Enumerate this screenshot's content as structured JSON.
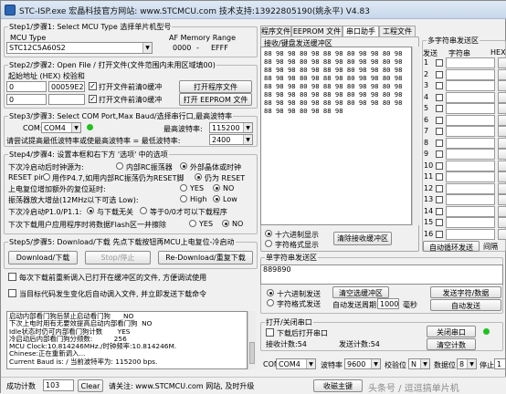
{
  "app": {
    "title": "STC-ISP.exe    宏晶科技官方网站: www.STCMCU.com  技术支持:13922805190(姚永平)  V4.83",
    "accent_color": "#2a66b8"
  },
  "step1": {
    "label": "Step1/步骤1: Select MCU Type  选择单片机型号",
    "mcu_type_label": "MCU Type",
    "af_label": "AF Memory Range",
    "mcu_value": "STC12C5A60S2",
    "range_start": "0000",
    "range_sep": "-",
    "range_end": "EFFF"
  },
  "step2": {
    "label": "Step2/步骤2: Open File / 打开文件(文件范围内未用区域填00)",
    "start_addr_label": "起始地址 (HEX)  校验和",
    "addr1": "0",
    "checksum1": "00059E2H",
    "clear_buffer1": "打开文件前清0缓冲",
    "open_program_btn": "打开程序文件",
    "addr2": "0",
    "checksum2": "",
    "clear_buffer2": "打开文件前清0缓冲",
    "open_eeprom_btn": "打开 EEPROM 文件"
  },
  "step3": {
    "label": "Step3/步骤3: Select COM Port,Max Baud/选择串行口,最高波特率",
    "com_label": "COM:",
    "com_value": "COM4",
    "max_baud_label": "最高波特率:",
    "max_baud_value": "115200",
    "min_note": "请尝试提高最低波特率或使最高波特率  =  最低波特率:",
    "min_baud_value": "2400"
  },
  "step4": {
    "label": "Step4/步骤4: 设置本框和右下方 '选项' 中的选项",
    "cold_boot_label": "下次冷启动后时钟源为:",
    "opt_internal_rc": "内部RC振荡器",
    "opt_external": "外部晶体或时钟",
    "reset_pin_label": "RESET pin",
    "opt_p4_7": "用作P4.7,如用内部RC振荡仍为RESET脚",
    "opt_reset": "仍为 RESET",
    "power_delay_label": "上电复位增加额外的复位延时:",
    "opt_yes": "YES",
    "opt_no": "NO",
    "osc_gain_label": "振荡器放大增益(12MHz以下可选 Low):",
    "opt_high": "High",
    "opt_low": "Low",
    "cold_boot_p1_label": "下次冷启动P1.0/P1.1:",
    "opt_p1_any": "与下载无关",
    "opt_p1_zero": "等于0/0才可以下载程序",
    "next_download_label": "下次下载用户应用程序时将数据Flash区一并擦除",
    "opt_yes2": "YES",
    "opt_no2": "NO"
  },
  "step5": {
    "label": "Step5/步骤5: Download/下载   先点下载按钮再MCU上电复位-冷启动",
    "download_btn": "Download/下载",
    "stop_btn": "Stop/停止",
    "redownload_btn": "Re-Download/重复下载",
    "reload_note": "每次下载前重新调入已打开在缓冲区的文件, 方便调试使用",
    "auto_load_note": "当目标代码发生变化后自动调入文件, 并立即发送下载命令"
  },
  "log": {
    "lines": [
      "启动内部看门狗后禁止启动看门狗      NO",
      "下次上电时用有无要效提高启动内部看门狗  NO",
      "Idle状态时仍可内部看门狗计数       YES",
      "冷启动后内部看门狗分频数:          256",
      "MCU Clock:10.814246MHz./时钟频率:10.814246M.",
      "Chinese:正在重新调入...",
      "Current Baud is: / 当前波特率为: 115200 bps."
    ]
  },
  "status": {
    "success_label": "成功计数",
    "success_count": "103",
    "clear_btn": "Clear",
    "visit_note": "请关注: www.STCMCU.com 网站, 及时升级"
  },
  "tabs": {
    "items": [
      "程序文件",
      "EEPROM 文件",
      "串口助手",
      "工程文件"
    ],
    "active_index": 2
  },
  "receive": {
    "label": "接收/键盘发送缓冲区",
    "lines": [
      "88 98 98 80 98 88 98 80 98 98 80 98",
      "88 98 98 80 98 88 98 80 98 98 80 98",
      "88 98 98 80 98 88 98 80 98 98 80 98",
      "88 98 98 80 98 88 98 80 98 98 80 98",
      "88 98 98 80 98 88 98 80 98 98 80 98",
      "88 98 98 80 98 88 98 80 98 98 80 98",
      "88 98 98 80 98 88 98 80 98 98 80 98",
      "88 98 98 80 98 88 98"
    ],
    "opt_hex": "十六进制显示",
    "opt_text": "字符格式显示",
    "clear_btn": "清除接收缓冲区"
  },
  "single_send": {
    "label": "单字符串发送区",
    "value": "889890",
    "opt_hex": "十六进制发送",
    "opt_text": "字符格式发送",
    "clear_btn": "清空选缓冲区",
    "auto_label": "自动发送周期",
    "period": "1000",
    "period_unit": "毫秒",
    "send_btn": "发送字符/数据",
    "auto_btn": "自动发送"
  },
  "serial": {
    "label": "打开/关闭串口",
    "open_label": "下载后打开串口",
    "rx_label": "接收计数:54",
    "tx_label": "发送计数:54",
    "close_btn": "关闭串口",
    "clear_btn": "清空计数",
    "led_color": "#22c022"
  },
  "multi": {
    "label": "多字符串发送区",
    "col_send": "发送",
    "col_string": "字符串",
    "col_hex": "HEX",
    "rows": [
      "1",
      "2",
      "3",
      "4",
      "5",
      "6",
      "7",
      "8",
      "9",
      "10",
      "11",
      "12",
      "13",
      "14",
      "15",
      "16"
    ],
    "loop_btn": "自动循环发送",
    "interval_label": "间隔"
  },
  "bottom_bar": {
    "com_label": "COM",
    "com_value": "COM4",
    "baud_label": "波特率",
    "baud_value": "9600",
    "parity_label": "校验位",
    "parity_value": "N",
    "data_label": "数据位",
    "data_value": "8",
    "stop_label": "停止位",
    "stop_value": "1",
    "input_method": "收磁主键",
    "watermark": "头条号 / 逗逗搞单片机"
  }
}
